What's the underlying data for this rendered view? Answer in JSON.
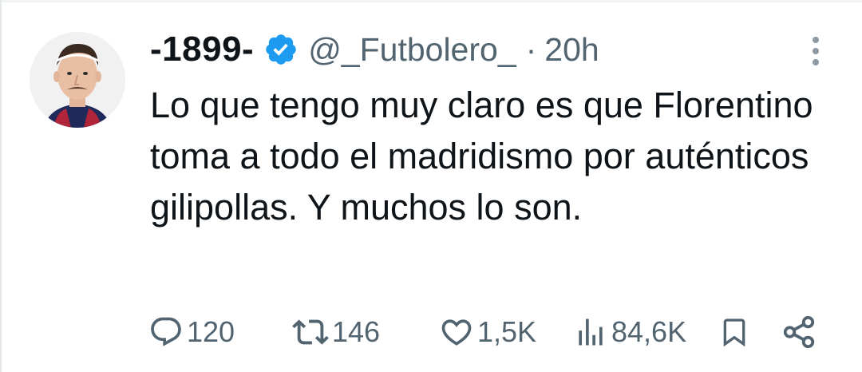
{
  "tweet": {
    "display_name": "-1899-",
    "handle": "@_Futbolero_",
    "separator": "·",
    "time": "20h",
    "verified": true,
    "text": "Lo que tengo muy claro es que Florentino toma a todo el madridismo por auténticos gilipollas. Y muchos lo son."
  },
  "actions": {
    "replies": "120",
    "retweets": "146",
    "likes": "1,5K",
    "views": "84,6K"
  },
  "colors": {
    "text": "#0f1419",
    "secondary": "#536471",
    "verified_badge": "#1d9bf0"
  },
  "icons": {
    "verified": "verified-badge-icon",
    "more": "more-vertical-icon",
    "reply": "reply-icon",
    "retweet": "retweet-icon",
    "like": "heart-icon",
    "views": "views-chart-icon",
    "bookmark": "bookmark-icon",
    "share": "share-icon"
  }
}
